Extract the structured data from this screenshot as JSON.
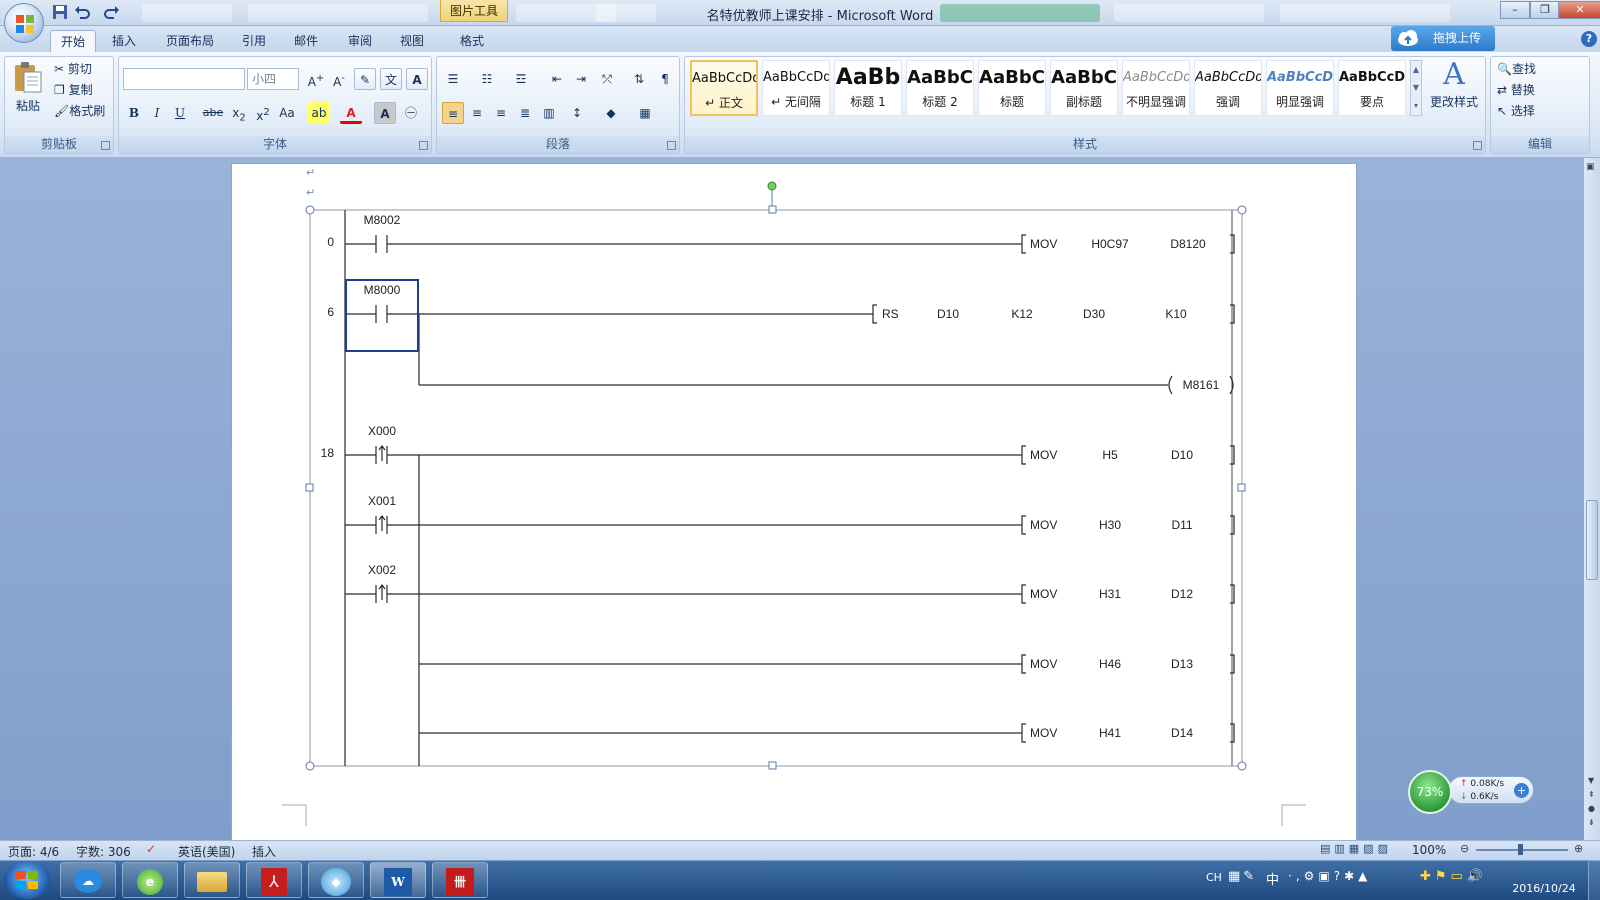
{
  "window": {
    "title": "名特优教师上课安排 - Microsoft Word",
    "picture_tools_label": "图片工具",
    "buttons": {
      "minimize": "–",
      "restore": "❐",
      "close": "✕"
    }
  },
  "ribbon": {
    "tabs": [
      {
        "label": "开始"
      },
      {
        "label": "插入"
      },
      {
        "label": "页面布局"
      },
      {
        "label": "引用"
      },
      {
        "label": "邮件"
      },
      {
        "label": "审阅"
      },
      {
        "label": "视图"
      },
      {
        "label": "格式"
      }
    ],
    "active_tab": "开始",
    "upload_label": "拖拽上传",
    "clipboard": {
      "paste": "粘贴",
      "cut": "剪切",
      "copy": "复制",
      "format_painter": "格式刷",
      "group": "剪贴板"
    },
    "font": {
      "font_name": "",
      "font_size": "小四",
      "group": "字体"
    },
    "paragraph": {
      "group": "段落"
    },
    "styles": {
      "items": [
        {
          "preview": "AaBbCcDd",
          "name": "↵ 正文"
        },
        {
          "preview": "AaBbCcDd",
          "name": "↵ 无间隔"
        },
        {
          "preview": "AaBb",
          "name": "标题 1"
        },
        {
          "preview": "AaBbC",
          "name": "标题 2"
        },
        {
          "preview": "AaBbC",
          "name": "标题"
        },
        {
          "preview": "AaBbC",
          "name": "副标题"
        },
        {
          "preview": "AaBbCcDd",
          "name": "不明显强调"
        },
        {
          "preview": "AaBbCcDd",
          "name": "强调"
        },
        {
          "preview": "AaBbCcDd",
          "name": "明显强调"
        },
        {
          "preview": "AaBbCcDd",
          "name": "要点"
        }
      ],
      "change_styles": "更改样式",
      "group": "样式"
    },
    "editing": {
      "find": "查找",
      "replace": "替换",
      "select": "选择",
      "group": "编辑"
    }
  },
  "ladder": {
    "rungs": [
      {
        "step": "0",
        "contact": "M8002",
        "instruction": [
          "MOV",
          "H0C97",
          "D8120"
        ]
      },
      {
        "step": "6",
        "contact": "M8000",
        "instruction": [
          "RS",
          "D10",
          "K12",
          "D30",
          "K10"
        ],
        "coil": "M8161"
      },
      {
        "step": "18",
        "contacts": [
          "X000",
          "X001",
          "X002"
        ],
        "moves": [
          [
            "MOV",
            "H5",
            "D10"
          ],
          [
            "MOV",
            "H30",
            "D11"
          ],
          [
            "MOV",
            "H31",
            "D12"
          ],
          [
            "MOV",
            "H46",
            "D13"
          ],
          [
            "MOV",
            "H41",
            "D14"
          ]
        ]
      }
    ]
  },
  "status": {
    "page": "页面: 4/6",
    "words": "字数: 306",
    "language": "英语(美国)",
    "mode": "插入",
    "zoom": "100%"
  },
  "network": {
    "percent": "73%",
    "up": "0.08K/s",
    "down": "0.6K/s"
  },
  "tray": {
    "ime": "CH",
    "ime2": "中",
    "date": "2016/10/24"
  },
  "taskbar_apps": [
    "cloud",
    "browser",
    "explorer",
    "pdf",
    "dolphin",
    "word",
    "app"
  ]
}
